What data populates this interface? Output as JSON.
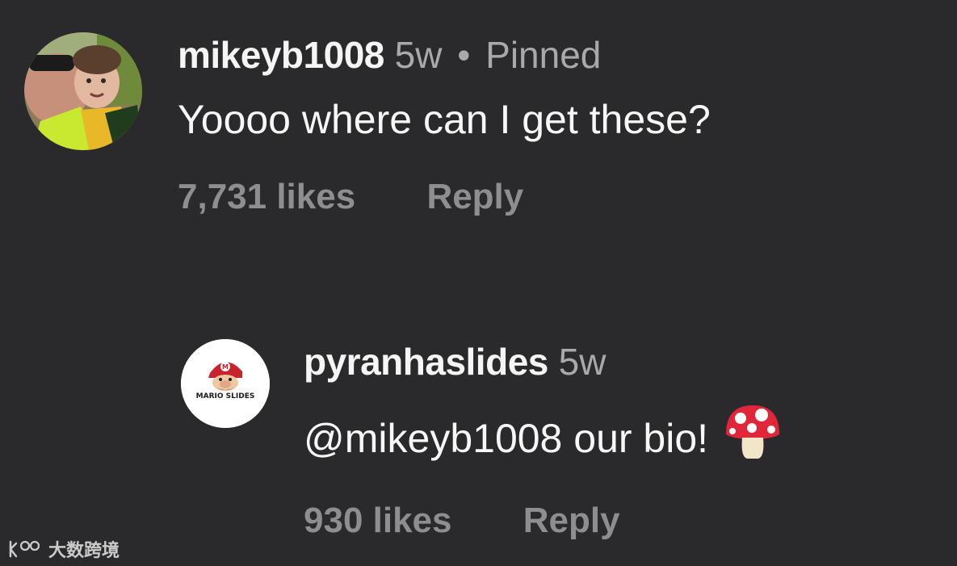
{
  "comments": [
    {
      "username": "mikeyb1008",
      "age": "5w",
      "separator": "•",
      "pinned": "Pinned",
      "text": "Yoooo where can I get these?",
      "likes": "7,731 likes",
      "reply": "Reply",
      "avatar": "photo-avatar"
    },
    {
      "username": "pyranhaslides",
      "age": "5w",
      "mention": "@mikeyb1008",
      "text": " our bio!",
      "emoji": "mushroom-emoji",
      "likes": "930 likes",
      "reply": "Reply",
      "avatar": "mario-slides-logo",
      "avatar_text": "MARIO SLIDES"
    }
  ],
  "watermark": {
    "text": "大数跨境"
  },
  "colors": {
    "background": "#2a2a2c",
    "primary_text": "#f5f5f5",
    "secondary_text": "#a9a9ad",
    "action_text": "#8e8e92"
  }
}
